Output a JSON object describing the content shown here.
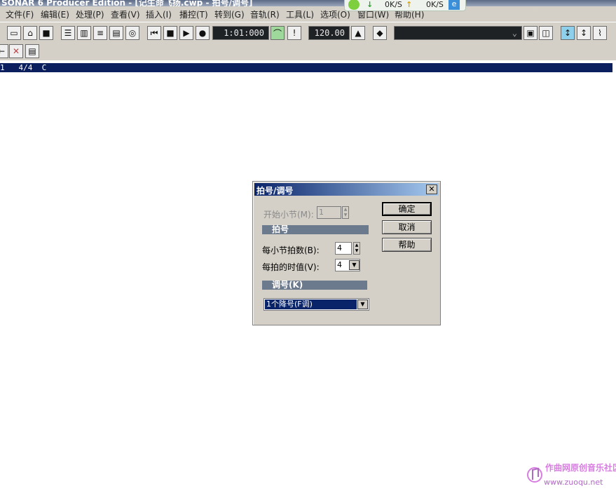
{
  "window": {
    "title": "SONAR 6 Producer Edition - [记生命飞扬.cwp - 拍号/调号]"
  },
  "menu": [
    {
      "label": "文件(F)"
    },
    {
      "label": "编辑(E)"
    },
    {
      "label": "处理(P)"
    },
    {
      "label": "查看(V)"
    },
    {
      "label": "插入(I)"
    },
    {
      "label": "播控(T)"
    },
    {
      "label": "转到(G)"
    },
    {
      "label": "音轨(R)"
    },
    {
      "label": "工具(L)"
    },
    {
      "label": "选项(O)"
    },
    {
      "label": "窗口(W)"
    },
    {
      "label": "帮助(H)"
    }
  ],
  "net": {
    "down": "0K/S",
    "up": "0K/S"
  },
  "transport": {
    "time": "1:01:000",
    "tempo": "120.00"
  },
  "strip": {
    "text": "1   4/4  C"
  },
  "dialog": {
    "title": "拍号/调号",
    "start_measure_label": "开始小节(M):",
    "start_measure_value": "1",
    "meter_group": "拍号",
    "beats_label": "每小节拍数(B):",
    "beats_value": "4",
    "beat_value_label": "每拍的时值(V):",
    "beat_value_value": "4",
    "key_group": "调号(K)",
    "key_value": "1个降号(F调)",
    "ok": "确定",
    "cancel": "取消",
    "help": "帮助"
  },
  "watermark": {
    "name": "作曲网原创音乐社区",
    "url": "www.zuoqu.net"
  }
}
